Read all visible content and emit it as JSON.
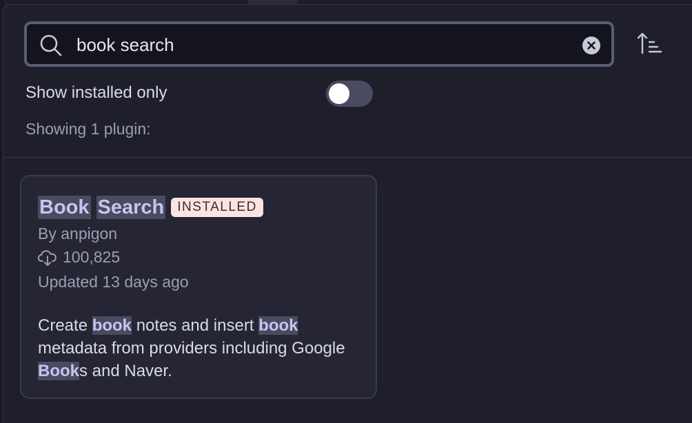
{
  "search": {
    "value": "book search",
    "placeholder": ""
  },
  "filters": {
    "installed_only_label": "Show installed only",
    "installed_only_enabled": false
  },
  "results": {
    "count_text": "Showing 1 plugin:"
  },
  "plugin": {
    "title_words": [
      "Book",
      "Search"
    ],
    "badge": "INSTALLED",
    "author": "By anpigon",
    "downloads": "100,825",
    "updated": "Updated 13 days ago",
    "description": {
      "p1": "Create ",
      "h1": "book",
      "p2": " notes and insert ",
      "h2": "book",
      "p3": " metadata from providers including Google ",
      "h3": "Book",
      "p4": "s and Naver."
    }
  },
  "icons": {
    "search": "search-icon",
    "clear": "clear-icon",
    "sort": "sort-ascending-icon",
    "download": "download-cloud-icon"
  },
  "colors": {
    "background": "#1f1f2b",
    "highlight": "#4a4a60",
    "badge_bg": "#fbe3df",
    "accent_text": "#c3c6ef"
  }
}
